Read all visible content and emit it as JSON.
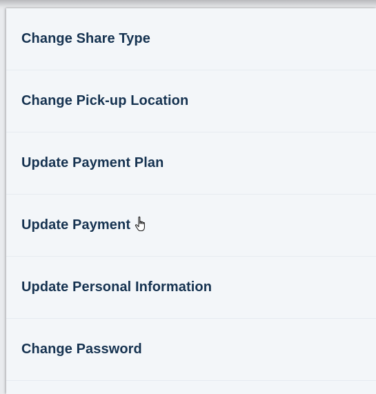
{
  "menu": {
    "items": [
      {
        "label": "Change Share Type"
      },
      {
        "label": "Change Pick-up Location"
      },
      {
        "label": "Update Payment Plan"
      },
      {
        "label": "Update Payment"
      },
      {
        "label": "Update Personal Information"
      },
      {
        "label": "Change Password"
      }
    ]
  },
  "colors": {
    "text": "#153250",
    "panel_background": "#f3f6f9",
    "divider": "#e6ebf0"
  },
  "cursor": {
    "icon": "hand-pointer-icon"
  }
}
